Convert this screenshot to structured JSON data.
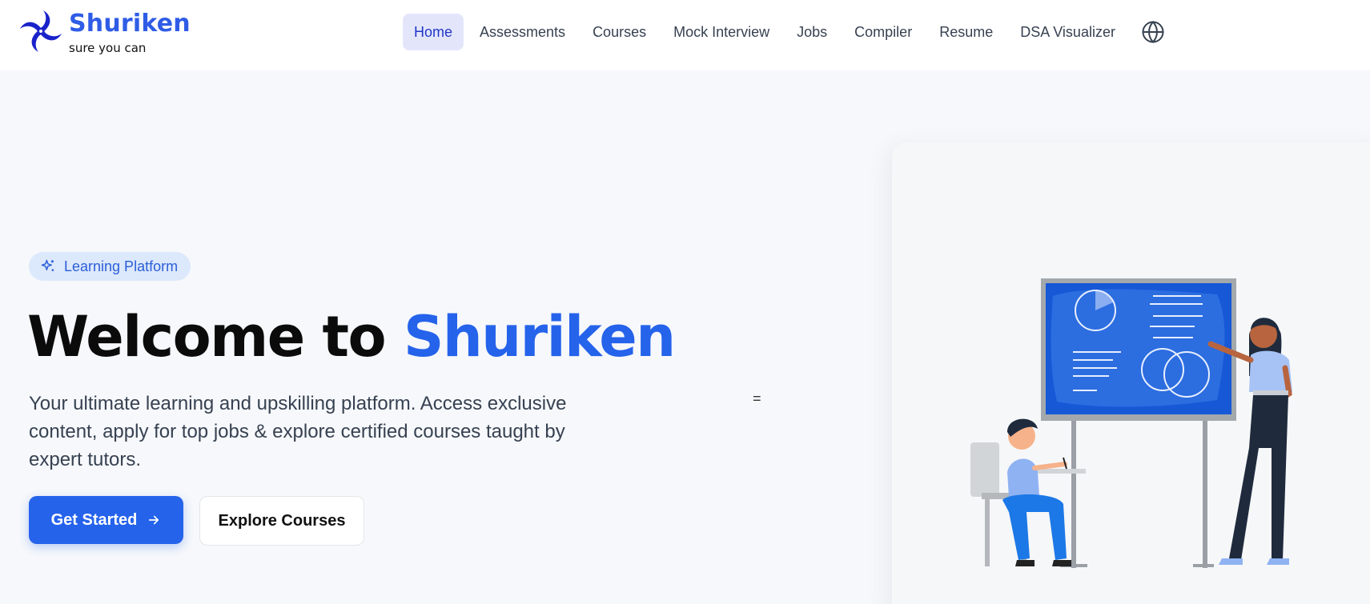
{
  "brand": {
    "name": "Shuriken",
    "tagline": "sure you can",
    "color": "#2f5ce6"
  },
  "nav": {
    "items": [
      {
        "label": "Home",
        "active": true
      },
      {
        "label": "Assessments"
      },
      {
        "label": "Courses"
      },
      {
        "label": "Mock Interview"
      },
      {
        "label": "Jobs"
      },
      {
        "label": "Compiler"
      },
      {
        "label": "Resume"
      },
      {
        "label": "DSA Visualizer"
      }
    ],
    "language_icon": "globe-icon"
  },
  "hero": {
    "badge": {
      "label": "Learning Platform",
      "icon": "sparkles-icon"
    },
    "headline_prefix": "Welcome to",
    "headline_accent": "Shuriken",
    "subtitle": "Your ultimate learning and upskilling platform. Access exclusive content, apply for top jobs & explore certified courses taught by expert tutors.",
    "primary_cta": {
      "label": "Get Started",
      "icon": "arrow-right-icon"
    },
    "secondary_cta": {
      "label": "Explore Courses"
    },
    "stray_text": "="
  },
  "illustration": {
    "name": "classroom-teacher-student-illustration"
  },
  "colors": {
    "accent": "#2563eb",
    "active_nav_bg": "#e3e6fb",
    "badge_bg": "#dce8fb",
    "page_bg": "#f6f8fb"
  }
}
